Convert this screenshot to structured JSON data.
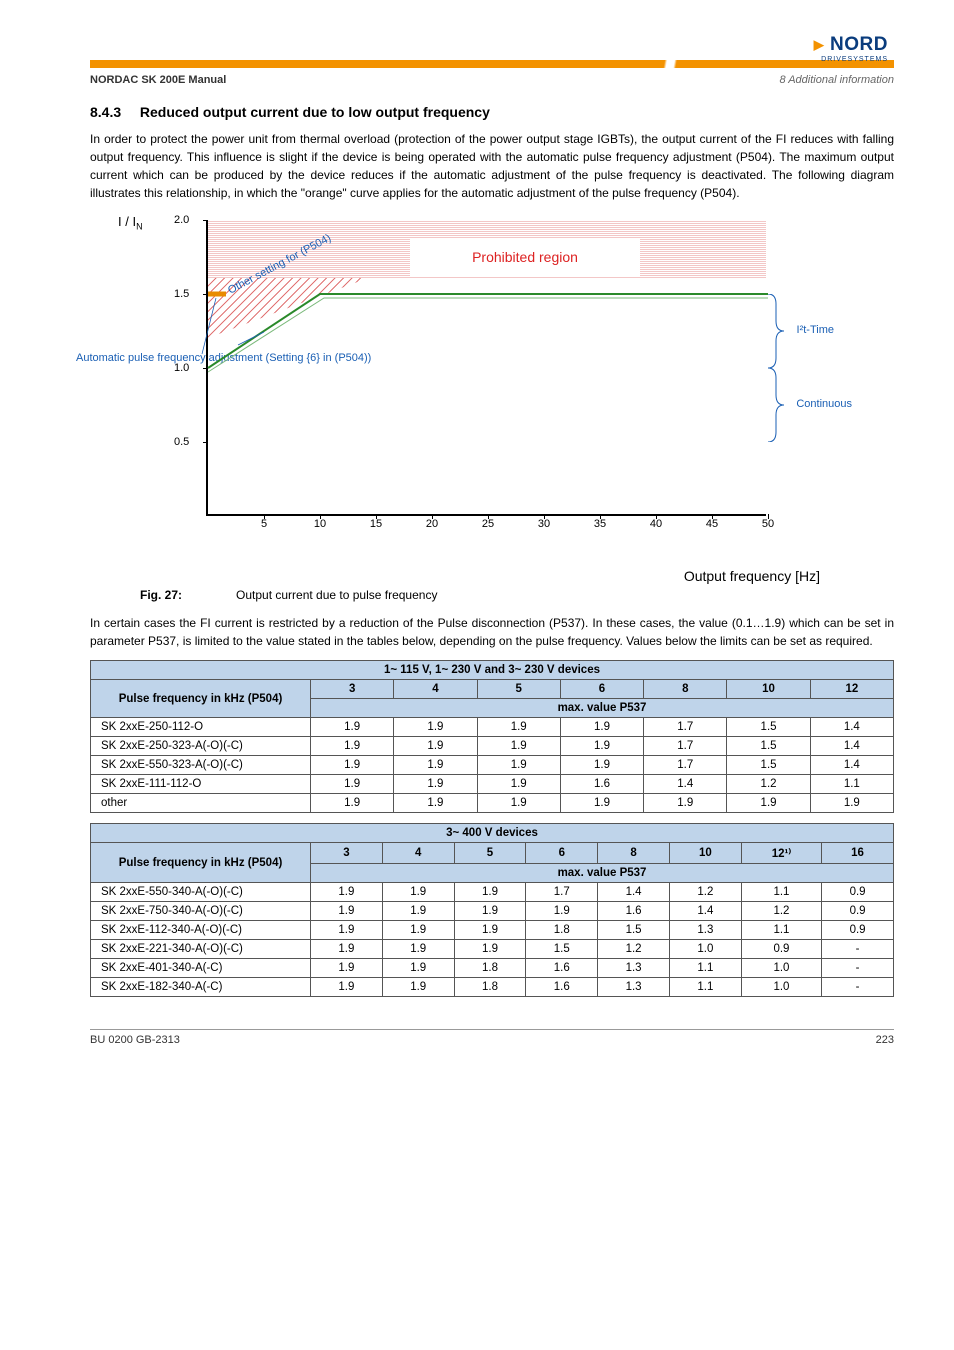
{
  "header": {
    "left_label": "NORDAC SK 200E Manual",
    "right_label": "8   Additional information",
    "logo_text": "NORD",
    "logo_sub": "DRIVESYSTEMS"
  },
  "section": {
    "number": "8.4.3",
    "title": "Reduced output current due to low output frequency"
  },
  "intro_paragraphs": [
    "In order to protect the power unit from thermal overload (protection of the power output stage IGBTs), the output current of the FI reduces with falling output frequency. This influence is slight if the device is being operated with the automatic pulse frequency adjustment (P504). The maximum output current which can be produced by the device reduces if the automatic adjustment of the pulse frequency is deactivated. The following diagram illustrates this relationship, in which the \"orange\" curve applies for the automatic adjustment of the pulse frequency (P504)."
  ],
  "chart_data": {
    "type": "line",
    "title": "",
    "xlabel": "Output frequency [Hz]",
    "ylabel": "I / I_N",
    "xlim": [
      0,
      50
    ],
    "ylim": [
      0,
      2.1
    ],
    "x_ticks": [
      5,
      10,
      15,
      20,
      25,
      30,
      35,
      40,
      45,
      50
    ],
    "y_ticks": [
      0.5,
      1.0,
      1.5,
      2.0
    ],
    "prohibited_label": "Prohibited region",
    "prohibited_band_y": [
      1.5,
      2.0
    ],
    "series": [
      {
        "name": "Other setting for (P504)",
        "color": "#2a8a2a",
        "points": [
          [
            0,
            1.0
          ],
          [
            10,
            1.5
          ],
          [
            50,
            1.5
          ]
        ]
      },
      {
        "name": "Automatic pulse frequency adjustment (Setting {6} in (P504))",
        "color": "#e88b00",
        "points": [
          [
            0,
            1.5
          ],
          [
            50,
            1.5
          ]
        ]
      }
    ],
    "annotations": [
      {
        "text": "I²t-Time",
        "y_range": [
          1.0,
          1.5
        ],
        "side": "right"
      },
      {
        "text": "Continuous",
        "y_range": [
          0.5,
          1.0
        ],
        "side": "right"
      },
      {
        "text": "Other setting for (P504)",
        "xy": [
          2,
          1.1
        ],
        "color": "#1a5fb4"
      },
      {
        "text": "Automatic pulse frequency adjustment\n(Setting {6} in (P504))",
        "xy": [
          -5,
          1.35
        ],
        "color": "#1a5fb4"
      }
    ]
  },
  "figure_caption": {
    "ref": "Fig. 27:",
    "text": "Output current due to pulse frequency"
  },
  "post_chart_paragraph": "In certain cases the FI current is restricted by a reduction of the Pulse disconnection (P537). In these cases, the value (0.1…1.9) which can be set in parameter P537, is limited to the value stated in the tables below, depending on the pulse frequency. Values below the limits can be set as required.",
  "tables": [
    {
      "title": "1~ 115 V, 1~ 230 V and 3~ 230 V devices",
      "row_header": "Pulse frequency in kHz (P504)",
      "col_headers": [
        "3",
        "4",
        "5",
        "6",
        "8",
        "10",
        "12"
      ],
      "sub_header": "max. value P537",
      "rows": [
        {
          "label": "SK 2xxE-250-112-O",
          "values": [
            "1.9",
            "1.9",
            "1.9",
            "1.9",
            "1.7",
            "1.5",
            "1.4"
          ]
        },
        {
          "label": "SK 2xxE-250-323-A(-O)(-C)",
          "values": [
            "1.9",
            "1.9",
            "1.9",
            "1.9",
            "1.7",
            "1.5",
            "1.4"
          ]
        },
        {
          "label": "SK 2xxE-550-323-A(-O)(-C)",
          "values": [
            "1.9",
            "1.9",
            "1.9",
            "1.9",
            "1.7",
            "1.5",
            "1.4"
          ]
        },
        {
          "label": "SK 2xxE-111-112-O",
          "values": [
            "1.9",
            "1.9",
            "1.9",
            "1.6",
            "1.4",
            "1.2",
            "1.1"
          ]
        },
        {
          "label": "other",
          "values": [
            "1.9",
            "1.9",
            "1.9",
            "1.9",
            "1.9",
            "1.9",
            "1.9"
          ]
        }
      ]
    },
    {
      "title": "3~ 400 V devices",
      "row_header": "Pulse frequency in kHz (P504)",
      "col_headers": [
        "3",
        "4",
        "5",
        "6",
        "8",
        "10",
        "12¹⁾",
        "16"
      ],
      "sub_header": "max. value P537",
      "rows": [
        {
          "label": "SK 2xxE-550-340-A(-O)(-C)",
          "values": [
            "1.9",
            "1.9",
            "1.9",
            "1.7",
            "1.4",
            "1.2",
            "1.1",
            "0.9"
          ]
        },
        {
          "label": "SK 2xxE-750-340-A(-O)(-C)",
          "values": [
            "1.9",
            "1.9",
            "1.9",
            "1.9",
            "1.6",
            "1.4",
            "1.2",
            "0.9"
          ]
        },
        {
          "label": "SK 2xxE-112-340-A(-O)(-C)",
          "values": [
            "1.9",
            "1.9",
            "1.9",
            "1.8",
            "1.5",
            "1.3",
            "1.1",
            "0.9"
          ]
        },
        {
          "label": "SK 2xxE-221-340-A(-O)(-C)",
          "values": [
            "1.9",
            "1.9",
            "1.9",
            "1.5",
            "1.2",
            "1.0",
            "0.9",
            "-"
          ]
        },
        {
          "label": "SK 2xxE-401-340-A(-C)",
          "values": [
            "1.9",
            "1.9",
            "1.8",
            "1.6",
            "1.3",
            "1.1",
            "1.0",
            "-"
          ]
        },
        {
          "label": "SK 2xxE-182-340-A(-C)",
          "values": [
            "1.9",
            "1.9",
            "1.8",
            "1.6",
            "1.3",
            "1.1",
            "1.0",
            "-"
          ]
        }
      ]
    }
  ],
  "footer": {
    "doc_id": "BU 0200 GB-2313",
    "page": "223"
  },
  "axis_labels": {
    "y_sub": "N",
    "y_main": "I / I"
  }
}
